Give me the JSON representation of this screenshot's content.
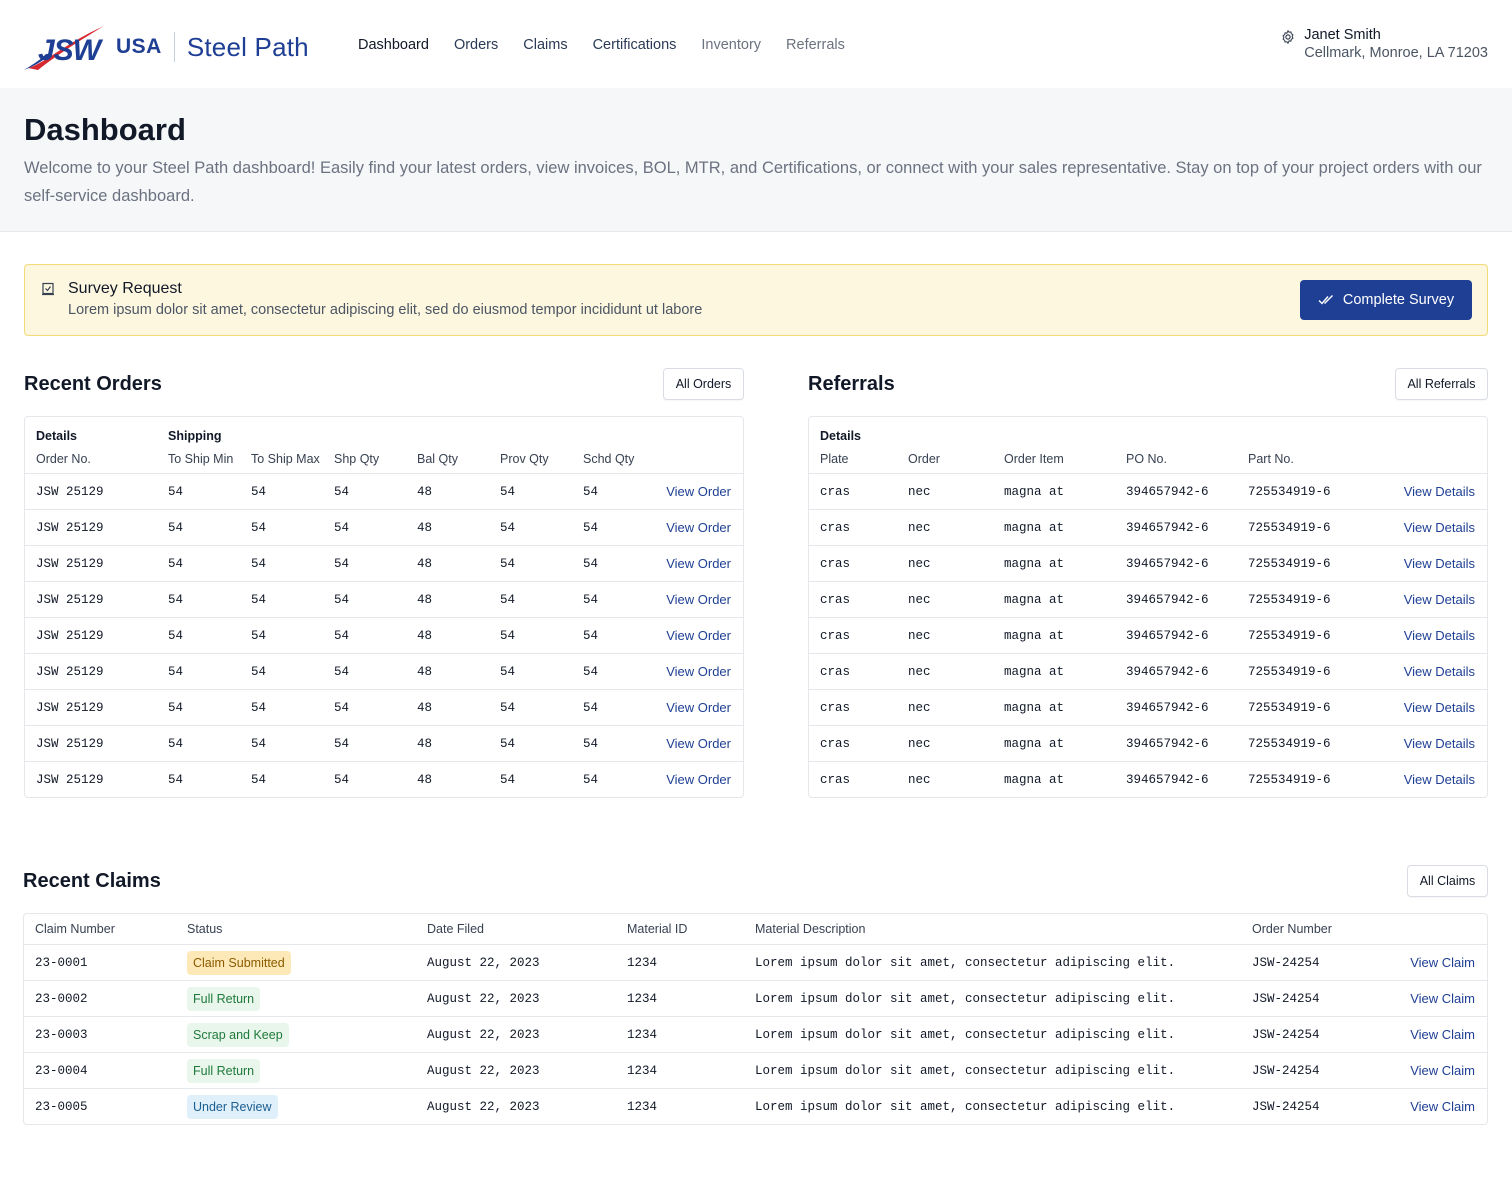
{
  "header": {
    "logo_brand": "JSW",
    "logo_region": "USA",
    "product": "Steel Path",
    "nav": [
      {
        "label": "Dashboard"
      },
      {
        "label": "Orders"
      },
      {
        "label": "Claims"
      },
      {
        "label": "Certifications"
      },
      {
        "label": "Inventory"
      },
      {
        "label": "Referrals"
      }
    ],
    "user_name": "Janet Smith",
    "user_location": "Cellmark, Monroe, LA 71203",
    "settings_icon": "gear-icon"
  },
  "hero": {
    "title": "Dashboard",
    "description": "Welcome to your Steel Path dashboard! Easily find your latest orders, view invoices, BOL, MTR, and Certifications, or connect with your sales representative. Stay on top of your project orders with our self-service dashboard."
  },
  "survey": {
    "icon": "survey-icon",
    "title": "Survey Request",
    "body": "Lorem ipsum dolor sit amet, consectetur adipiscing elit, sed do eiusmod tempor incididunt ut labore",
    "button_label": "Complete Survey",
    "button_icon": "double-check-icon",
    "accent": "#1e3f94",
    "background": "#fdf7e0"
  },
  "orders": {
    "title": "Recent Orders",
    "button_label": "All Orders",
    "group_details": "Details",
    "group_shipping": "Shipping",
    "columns": [
      "Order No.",
      "To Ship Min",
      "To Ship Max",
      "Shp Qty",
      "Bal Qty",
      "Prov Qty",
      "Schd Qty"
    ],
    "link_label": "View Order",
    "rows": [
      [
        "JSW 25129",
        "54",
        "54",
        "54",
        "48",
        "54",
        "54"
      ],
      [
        "JSW 25129",
        "54",
        "54",
        "54",
        "48",
        "54",
        "54"
      ],
      [
        "JSW 25129",
        "54",
        "54",
        "54",
        "48",
        "54",
        "54"
      ],
      [
        "JSW 25129",
        "54",
        "54",
        "54",
        "48",
        "54",
        "54"
      ],
      [
        "JSW 25129",
        "54",
        "54",
        "54",
        "48",
        "54",
        "54"
      ],
      [
        "JSW 25129",
        "54",
        "54",
        "54",
        "48",
        "54",
        "54"
      ],
      [
        "JSW 25129",
        "54",
        "54",
        "54",
        "48",
        "54",
        "54"
      ],
      [
        "JSW 25129",
        "54",
        "54",
        "54",
        "48",
        "54",
        "54"
      ],
      [
        "JSW 25129",
        "54",
        "54",
        "54",
        "48",
        "54",
        "54"
      ]
    ]
  },
  "referrals": {
    "title": "Referrals",
    "button_label": "All Referrals",
    "group_details": "Details",
    "columns": [
      "Plate",
      "Order",
      "Order Item",
      "PO No.",
      "Part No."
    ],
    "link_label": "View Details",
    "rows": [
      [
        "cras",
        "nec",
        "magna at",
        "394657942-6",
        "725534919-6"
      ],
      [
        "cras",
        "nec",
        "magna at",
        "394657942-6",
        "725534919-6"
      ],
      [
        "cras",
        "nec",
        "magna at",
        "394657942-6",
        "725534919-6"
      ],
      [
        "cras",
        "nec",
        "magna at",
        "394657942-6",
        "725534919-6"
      ],
      [
        "cras",
        "nec",
        "magna at",
        "394657942-6",
        "725534919-6"
      ],
      [
        "cras",
        "nec",
        "magna at",
        "394657942-6",
        "725534919-6"
      ],
      [
        "cras",
        "nec",
        "magna at",
        "394657942-6",
        "725534919-6"
      ],
      [
        "cras",
        "nec",
        "magna at",
        "394657942-6",
        "725534919-6"
      ],
      [
        "cras",
        "nec",
        "magna at",
        "394657942-6",
        "725534919-6"
      ]
    ]
  },
  "claims": {
    "title": "Recent Claims",
    "button_label": "All Claims",
    "columns": [
      "Claim Number",
      "Status",
      "Date Filed",
      "Material ID",
      "Material Description",
      "Order Number"
    ],
    "link_label": "View Claim",
    "rows": [
      {
        "number": "23-0001",
        "status": "Claim Submitted",
        "status_type": "submitted",
        "date": "August 22, 2023",
        "material_id": "1234",
        "description": "Lorem ipsum dolor sit amet, consectetur adipiscing elit.",
        "order": "JSW-24254"
      },
      {
        "number": "23-0002",
        "status": "Full Return",
        "status_type": "full",
        "date": "August 22, 2023",
        "material_id": "1234",
        "description": "Lorem ipsum dolor sit amet, consectetur adipiscing elit.",
        "order": "JSW-24254"
      },
      {
        "number": "23-0003",
        "status": "Scrap and Keep",
        "status_type": "scrap",
        "date": "August 22, 2023",
        "material_id": "1234",
        "description": "Lorem ipsum dolor sit amet, consectetur adipiscing elit.",
        "order": "JSW-24254"
      },
      {
        "number": "23-0004",
        "status": "Full Return",
        "status_type": "full",
        "date": "August 22, 2023",
        "material_id": "1234",
        "description": "Lorem ipsum dolor sit amet, consectetur adipiscing elit.",
        "order": "JSW-24254"
      },
      {
        "number": "23-0005",
        "status": "Under Review",
        "status_type": "review",
        "date": "August 22, 2023",
        "material_id": "1234",
        "description": "Lorem ipsum dolor sit amet, consectetur adipiscing elit.",
        "order": "JSW-24254"
      }
    ]
  },
  "colors": {
    "brand_blue": "#1e3f94",
    "brand_red": "#d7282f",
    "status_submitted": "#fde9b8",
    "status_return": "#e9f6ec",
    "status_review": "#dff0fb"
  }
}
